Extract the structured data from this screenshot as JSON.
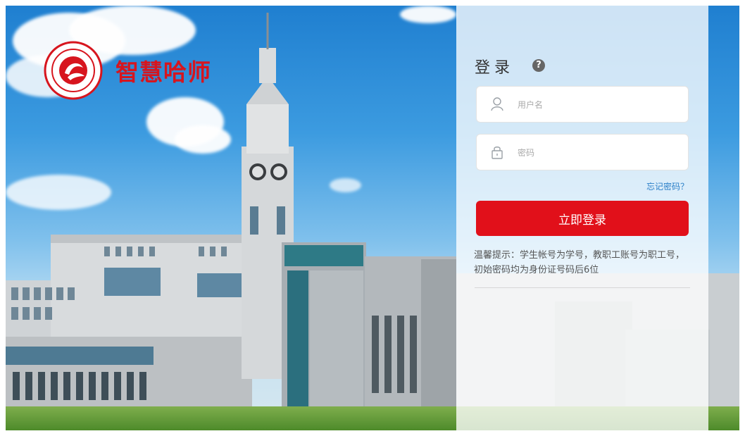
{
  "brand": {
    "name": "智慧哈师",
    "logo_icon": "university-seal-icon"
  },
  "login": {
    "title": "登录",
    "help_icon": "question-mark-icon",
    "help_text": "?",
    "username": {
      "placeholder": "用户名",
      "icon": "user-icon"
    },
    "password": {
      "placeholder": "密码",
      "icon": "lock-icon"
    },
    "forgot_label": "忘记密码？",
    "submit_label": "立即登录",
    "tip": "温馨提示：学生帐号为学号，教职工账号为职工号，初始密码均为身份证号码后6位"
  },
  "colors": {
    "accent": "#e1101a",
    "brand_red": "#d7151e",
    "link": "#2a7fc8"
  }
}
